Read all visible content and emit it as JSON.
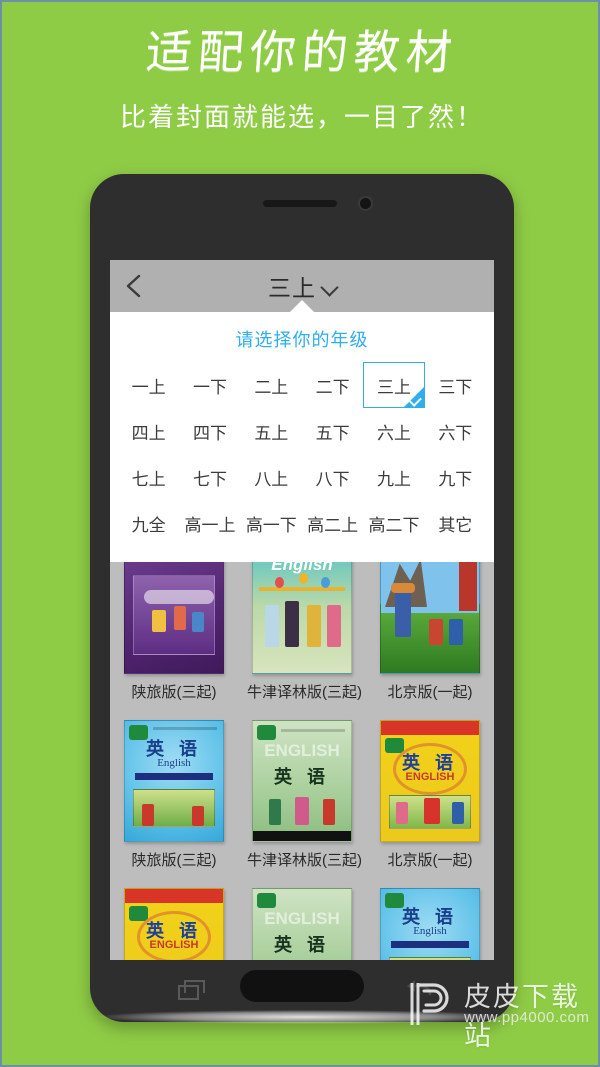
{
  "promo": {
    "title": "适配你的教材",
    "subtitle": "比着封面就能选，一目了然！",
    "background_color": "#8fcc46"
  },
  "phone": {
    "frame_color": "#2e2e2e",
    "nav": {
      "recent_apps_icon": "recent-apps-icon",
      "home_button": "home-button",
      "back_icon": "back-arrow-icon"
    }
  },
  "app": {
    "titlebar": {
      "back_icon": "chevron-left-icon",
      "title": "三上",
      "caret_icon": "chevron-down-icon",
      "background_color": "#b0b0b0"
    },
    "grade_picker": {
      "heading": "请选择你的年级",
      "heading_color": "#2eaeef",
      "selected": "三上",
      "accent_color": "#2eaeef",
      "check_icon": "check-icon",
      "grades": [
        "一上",
        "一下",
        "二上",
        "二下",
        "三上",
        "三下",
        "四上",
        "四下",
        "五上",
        "五下",
        "六上",
        "六下",
        "七上",
        "七下",
        "八上",
        "八下",
        "九上",
        "九下",
        "九全",
        "高一上",
        "高一下",
        "高二上",
        "高二下",
        "其它"
      ]
    },
    "book_list": {
      "background_color": "#bdbdbd",
      "rows": [
        {
          "books": [
            {
              "label": "陕旅版(三起)",
              "cover": "purple"
            },
            {
              "label": "牛津译林版(三起)",
              "cover": "teal"
            },
            {
              "label": "北京版(一起)",
              "cover": "field"
            }
          ]
        },
        {
          "books": [
            {
              "label": "陕旅版(三起)",
              "cover": "blue",
              "cover_title": "英 语",
              "cover_subtitle": "English"
            },
            {
              "label": "牛津译林版(三起)",
              "cover": "green",
              "cover_title": "英 语",
              "cover_subtitle": "ENGLISH"
            },
            {
              "label": "北京版(一起)",
              "cover": "yellow",
              "cover_title": "英 语",
              "cover_subtitle": "ENGLISH"
            }
          ]
        },
        {
          "books": [
            {
              "label": "",
              "cover": "yellow",
              "cover_title": "英 语",
              "cover_subtitle": "ENGLISH"
            },
            {
              "label": "",
              "cover": "green",
              "cover_title": "英 语",
              "cover_subtitle": "ENGLISH"
            },
            {
              "label": "",
              "cover": "blue",
              "cover_title": "英 语",
              "cover_subtitle": "English"
            }
          ]
        }
      ]
    }
  },
  "watermark": {
    "logo": "pp-logo-icon",
    "site_name": "皮皮下载站",
    "url": "www.pp4000.com"
  }
}
